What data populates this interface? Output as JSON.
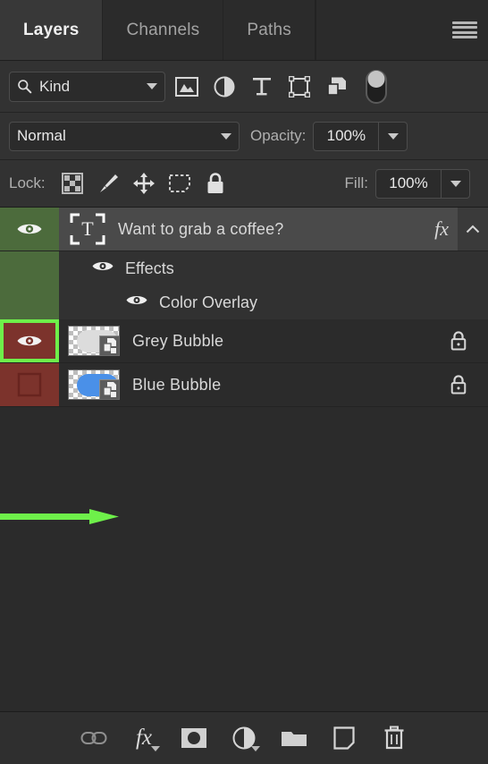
{
  "panel": {
    "tabs": [
      {
        "label": "Layers",
        "active": true
      },
      {
        "label": "Channels",
        "active": false
      },
      {
        "label": "Paths",
        "active": false
      }
    ],
    "menu_icon": "hamburger-menu-icon"
  },
  "filter": {
    "kind_label": "Kind",
    "search_icon": "search-icon",
    "icons": [
      "pixel-layer-filter-icon",
      "adjustment-layer-filter-icon",
      "type-layer-filter-icon",
      "shape-layer-filter-icon",
      "smart-object-filter-icon",
      "filter-toggle-switch"
    ]
  },
  "blend": {
    "mode": "Normal",
    "opacity_label": "Opacity:",
    "opacity_value": "100%"
  },
  "lock": {
    "lock_label": "Lock:",
    "icons": [
      "lock-transparent-pixels-icon",
      "lock-image-pixels-icon",
      "lock-position-icon",
      "lock-nesting-icon",
      "lock-all-icon"
    ],
    "fill_label": "Fill:",
    "fill_value": "100%"
  },
  "layers": [
    {
      "name": "Want to grab a coffee?",
      "type": "text",
      "visible": true,
      "visibility_cell_color": "#4c6b3c",
      "selected": true,
      "has_fx": true,
      "fx_label": "fx",
      "locked": false,
      "expanded": true
    },
    {
      "name": "Grey Bubble",
      "type": "smart-object",
      "visible": true,
      "visibility_cell_color": "#7c332c",
      "highlighted": true,
      "selected": false,
      "has_fx": false,
      "locked": true,
      "thumb_color": "#dcdcdc"
    },
    {
      "name": "Blue Bubble",
      "type": "smart-object",
      "visible": false,
      "visibility_cell_color": "#7c332c",
      "highlighted": false,
      "selected": false,
      "has_fx": false,
      "locked": true,
      "thumb_color": "#4a90e8"
    }
  ],
  "effects": [
    {
      "name": "Effects",
      "visible": true,
      "sub": false
    },
    {
      "name": "Color Overlay",
      "visible": true,
      "sub": true
    }
  ],
  "bottom_bar": {
    "icons": [
      "link-layers-icon",
      "add-layer-style-icon",
      "add-layer-mask-icon",
      "new-adjustment-layer-icon",
      "new-group-icon",
      "new-layer-icon",
      "delete-layer-icon"
    ],
    "fx_label": "fx"
  },
  "annotation": {
    "arrow_color": "#6ef04a",
    "highlight_color": "#6ef04a"
  }
}
